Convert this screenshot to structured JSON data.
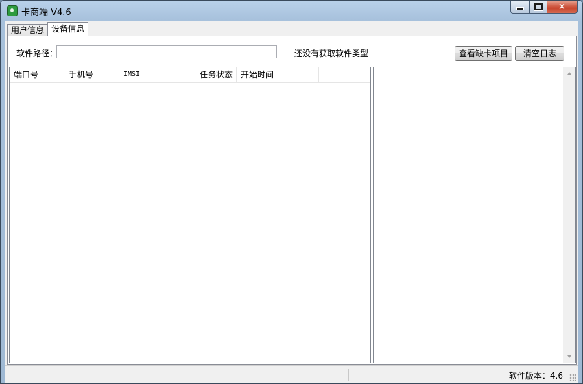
{
  "window": {
    "title": "卡商端 V4.6"
  },
  "tabs": [
    {
      "label": "用户信息"
    },
    {
      "label": "设备信息"
    }
  ],
  "device": {
    "path_label": "软件路径：",
    "path_value": "",
    "software_status": "还没有获取软件类型",
    "buttons": {
      "view_lack": "查看缺卡项目",
      "clear_log": "清空日志"
    }
  },
  "table": {
    "columns": [
      "端口号",
      "手机号",
      "IMSI",
      "任务状态",
      "开始时间"
    ],
    "rows": []
  },
  "log": {
    "text": ""
  },
  "statusbar": {
    "version": "软件版本：4.6"
  }
}
